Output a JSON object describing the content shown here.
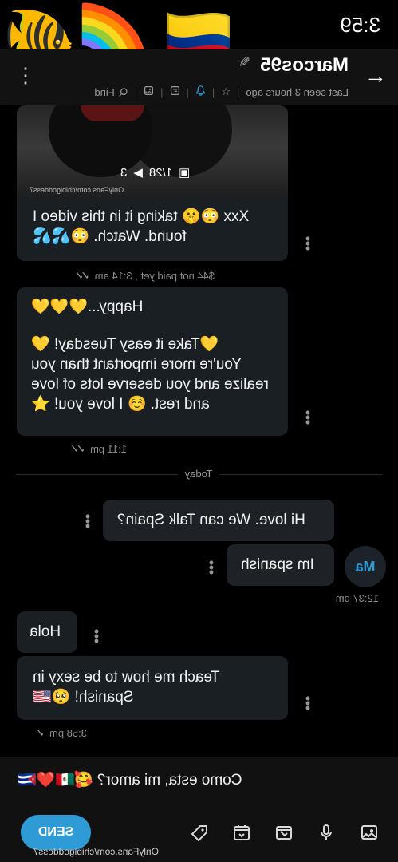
{
  "status": {
    "time": "3:59"
  },
  "stickers": {
    "fish": "🐠",
    "rainbow": "🌈",
    "flag": "🇨🇴"
  },
  "header": {
    "back_icon": "←",
    "name": "Marcos95",
    "edit_icon": "✎",
    "more_icon": "⋮",
    "last_seen": "Last seen 3 hours ago",
    "star_icon": "☆",
    "bell_icon": "🔔",
    "find_label": "Find"
  },
  "messages": {
    "m1": {
      "media_count": "1/28",
      "media_video": "3",
      "watermark": "OnlyFans.com/chibigoddess7",
      "text": "Xxx 😳🤫 taking it in this video I found. Watch. 😳💦💦",
      "meta": "$44 not paid yet , 3:14 am"
    },
    "m2": {
      "line1": "Happy...💛💛💛",
      "line2": "💛Take it easy Tuesday! 💛",
      "line3": "You're more important than you realize and you deserve lots of love and rest. ☺️ I love you! ⭐",
      "meta": "1:11 pm"
    },
    "today_label": "Today",
    "m3": {
      "text": "Hi love. We can Talk Spain?"
    },
    "m4": {
      "text": "Im spanish",
      "meta": "12:37 pm",
      "avatar": "Ma"
    },
    "m5": {
      "text": "Hola"
    },
    "m6": {
      "text": "Teach me how to be sexy in Spanish! 🥺🇺🇸",
      "meta": "3:58 pm"
    }
  },
  "composer": {
    "text": "Como esta, mi amor? 🥰🇲🇽❤️🇨🇺",
    "send_label": "SEND",
    "tools": [
      "image-icon",
      "mic-icon",
      "media-vault-icon",
      "schedule-icon",
      "price-tag-icon"
    ]
  },
  "footer": {
    "url": "OnlyFans.com/chibigoddess7"
  }
}
